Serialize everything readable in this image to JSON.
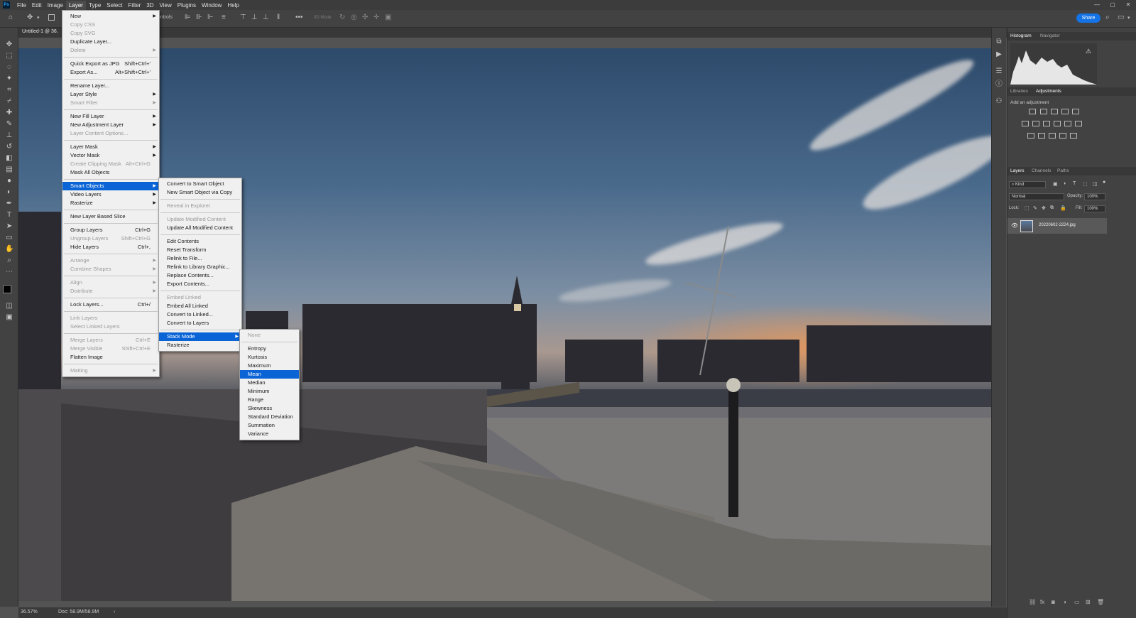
{
  "app": {
    "logo": "Ps"
  },
  "menubar": [
    "File",
    "Edit",
    "Image",
    "Layer",
    "Type",
    "Select",
    "Filter",
    "3D",
    "View",
    "Plugins",
    "Window",
    "Help"
  ],
  "window_controls": [
    "—",
    "▢",
    "✕"
  ],
  "options": {
    "align_label": "ontrols",
    "mode3d": "3D Mode:",
    "share": "Share"
  },
  "document": {
    "tab": "Untitled-1 @ 36.",
    "zoom": "36.57%",
    "doc_size": "Doc: 58.9M/58.9M"
  },
  "layer_menu": [
    {
      "label": "New",
      "sub": true
    },
    {
      "label": "Copy CSS",
      "dis": true
    },
    {
      "label": "Copy SVG",
      "dis": true
    },
    {
      "label": "Duplicate Layer..."
    },
    {
      "label": "Delete",
      "dis": true,
      "sub": true
    },
    {
      "sep": true
    },
    {
      "label": "Quick Export as JPG",
      "shortcut": "Shift+Ctrl+'"
    },
    {
      "label": "Export As...",
      "shortcut": "Alt+Shift+Ctrl+'"
    },
    {
      "sep": true
    },
    {
      "label": "Rename Layer..."
    },
    {
      "label": "Layer Style",
      "sub": true
    },
    {
      "label": "Smart Filter",
      "dis": true,
      "sub": true
    },
    {
      "sep": true
    },
    {
      "label": "New Fill Layer",
      "sub": true
    },
    {
      "label": "New Adjustment Layer",
      "sub": true
    },
    {
      "label": "Layer Content Options...",
      "dis": true
    },
    {
      "sep": true
    },
    {
      "label": "Layer Mask",
      "sub": true
    },
    {
      "label": "Vector Mask",
      "sub": true
    },
    {
      "label": "Create Clipping Mask",
      "dis": true,
      "shortcut": "Alt+Ctrl+G"
    },
    {
      "label": "Mask All Objects"
    },
    {
      "sep": true
    },
    {
      "label": "Smart Objects",
      "sub": true,
      "hl": true
    },
    {
      "label": "Video Layers",
      "sub": true
    },
    {
      "label": "Rasterize",
      "sub": true
    },
    {
      "sep": true
    },
    {
      "label": "New Layer Based Slice"
    },
    {
      "sep": true
    },
    {
      "label": "Group Layers",
      "shortcut": "Ctrl+G"
    },
    {
      "label": "Ungroup Layers",
      "dis": true,
      "shortcut": "Shift+Ctrl+G"
    },
    {
      "label": "Hide Layers",
      "shortcut": "Ctrl+,"
    },
    {
      "sep": true
    },
    {
      "label": "Arrange",
      "dis": true,
      "sub": true
    },
    {
      "label": "Combine Shapes",
      "dis": true,
      "sub": true
    },
    {
      "sep": true
    },
    {
      "label": "Align",
      "dis": true,
      "sub": true
    },
    {
      "label": "Distribute",
      "dis": true,
      "sub": true
    },
    {
      "sep": true
    },
    {
      "label": "Lock Layers...",
      "shortcut": "Ctrl+/"
    },
    {
      "sep": true
    },
    {
      "label": "Link Layers",
      "dis": true
    },
    {
      "label": "Select Linked Layers",
      "dis": true
    },
    {
      "sep": true
    },
    {
      "label": "Merge Layers",
      "dis": true,
      "shortcut": "Ctrl+E"
    },
    {
      "label": "Merge Visible",
      "dis": true,
      "shortcut": "Shift+Ctrl+E"
    },
    {
      "label": "Flatten Image"
    },
    {
      "sep": true
    },
    {
      "label": "Matting",
      "dis": true,
      "sub": true
    }
  ],
  "smart_objects_menu": [
    {
      "label": "Convert to Smart Object"
    },
    {
      "label": "New Smart Object via Copy"
    },
    {
      "sep": true
    },
    {
      "label": "Reveal in Explorer",
      "dis": true
    },
    {
      "sep": true
    },
    {
      "label": "Update Modified Content",
      "dis": true
    },
    {
      "label": "Update All Modified Content"
    },
    {
      "sep": true
    },
    {
      "label": "Edit Contents"
    },
    {
      "label": "Reset Transform"
    },
    {
      "label": "Relink to File..."
    },
    {
      "label": "Relink to Library Graphic..."
    },
    {
      "label": "Replace Contents..."
    },
    {
      "label": "Export Contents..."
    },
    {
      "sep": true
    },
    {
      "label": "Embed Linked",
      "dis": true
    },
    {
      "label": "Embed All Linked"
    },
    {
      "label": "Convert to Linked..."
    },
    {
      "label": "Convert to Layers"
    },
    {
      "sep": true
    },
    {
      "label": "Stack Mode",
      "sub": true,
      "hl": true
    },
    {
      "label": "Rasterize"
    }
  ],
  "stack_mode_menu": [
    {
      "label": "None",
      "dis": true
    },
    {
      "sep": true
    },
    {
      "label": "Entropy"
    },
    {
      "label": "Kurtosis"
    },
    {
      "label": "Maximum"
    },
    {
      "label": "Mean",
      "hl": true
    },
    {
      "label": "Median"
    },
    {
      "label": "Minimum"
    },
    {
      "label": "Range"
    },
    {
      "label": "Skewness"
    },
    {
      "label": "Standard Deviation"
    },
    {
      "label": "Summation"
    },
    {
      "label": "Variance"
    }
  ],
  "panels": {
    "histogram_tabs": [
      "Histogram",
      "Navigator"
    ],
    "adj_tabs": [
      "Libraries",
      "Adjustments"
    ],
    "add_adjustment": "Add an adjustment",
    "layers_tabs": [
      "Layers",
      "Channels",
      "Paths"
    ],
    "kind": "Kind",
    "blend_mode": "Normal",
    "opacity_label": "Opacity:",
    "opacity": "100%",
    "lock_label": "Lock:",
    "fill_label": "Fill:",
    "fill": "100%",
    "layer_name": "20220602-2224.jpg"
  }
}
